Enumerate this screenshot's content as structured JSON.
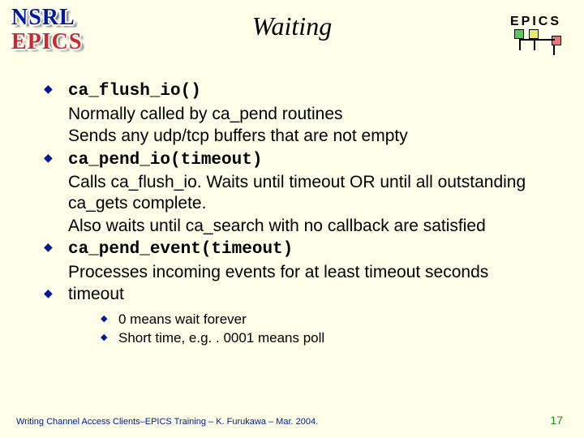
{
  "header": {
    "title": "Waiting",
    "epics_label": "EPICS",
    "side_nsrl": "NSRL",
    "side_epics": "EPICS"
  },
  "bullets": [
    {
      "code": "ca_flush_io()",
      "lines": [
        " Normally called by ca_pend routines",
        "Sends any udp/tcp buffers that are not empty"
      ]
    },
    {
      "code": "ca_pend_io(timeout)",
      "lines": [
        " Calls ca_flush_io. Waits until timeout OR until all outstanding ca_gets complete.",
        "Also waits until ca_search with no callback are satisfied"
      ]
    },
    {
      "code": "ca_pend_event(timeout)",
      "lines": [
        " Processes incoming events for at least timeout seconds"
      ]
    },
    {
      "code": "",
      "plain": "timeout",
      "lines": []
    }
  ],
  "subbullets": [
    "0 means wait forever",
    "Short time, e.g. . 0001 means poll"
  ],
  "footer": {
    "text": "Writing Channel Access Clients–EPICS Training – K. Furukawa – Mar. 2004.",
    "page": "17"
  }
}
